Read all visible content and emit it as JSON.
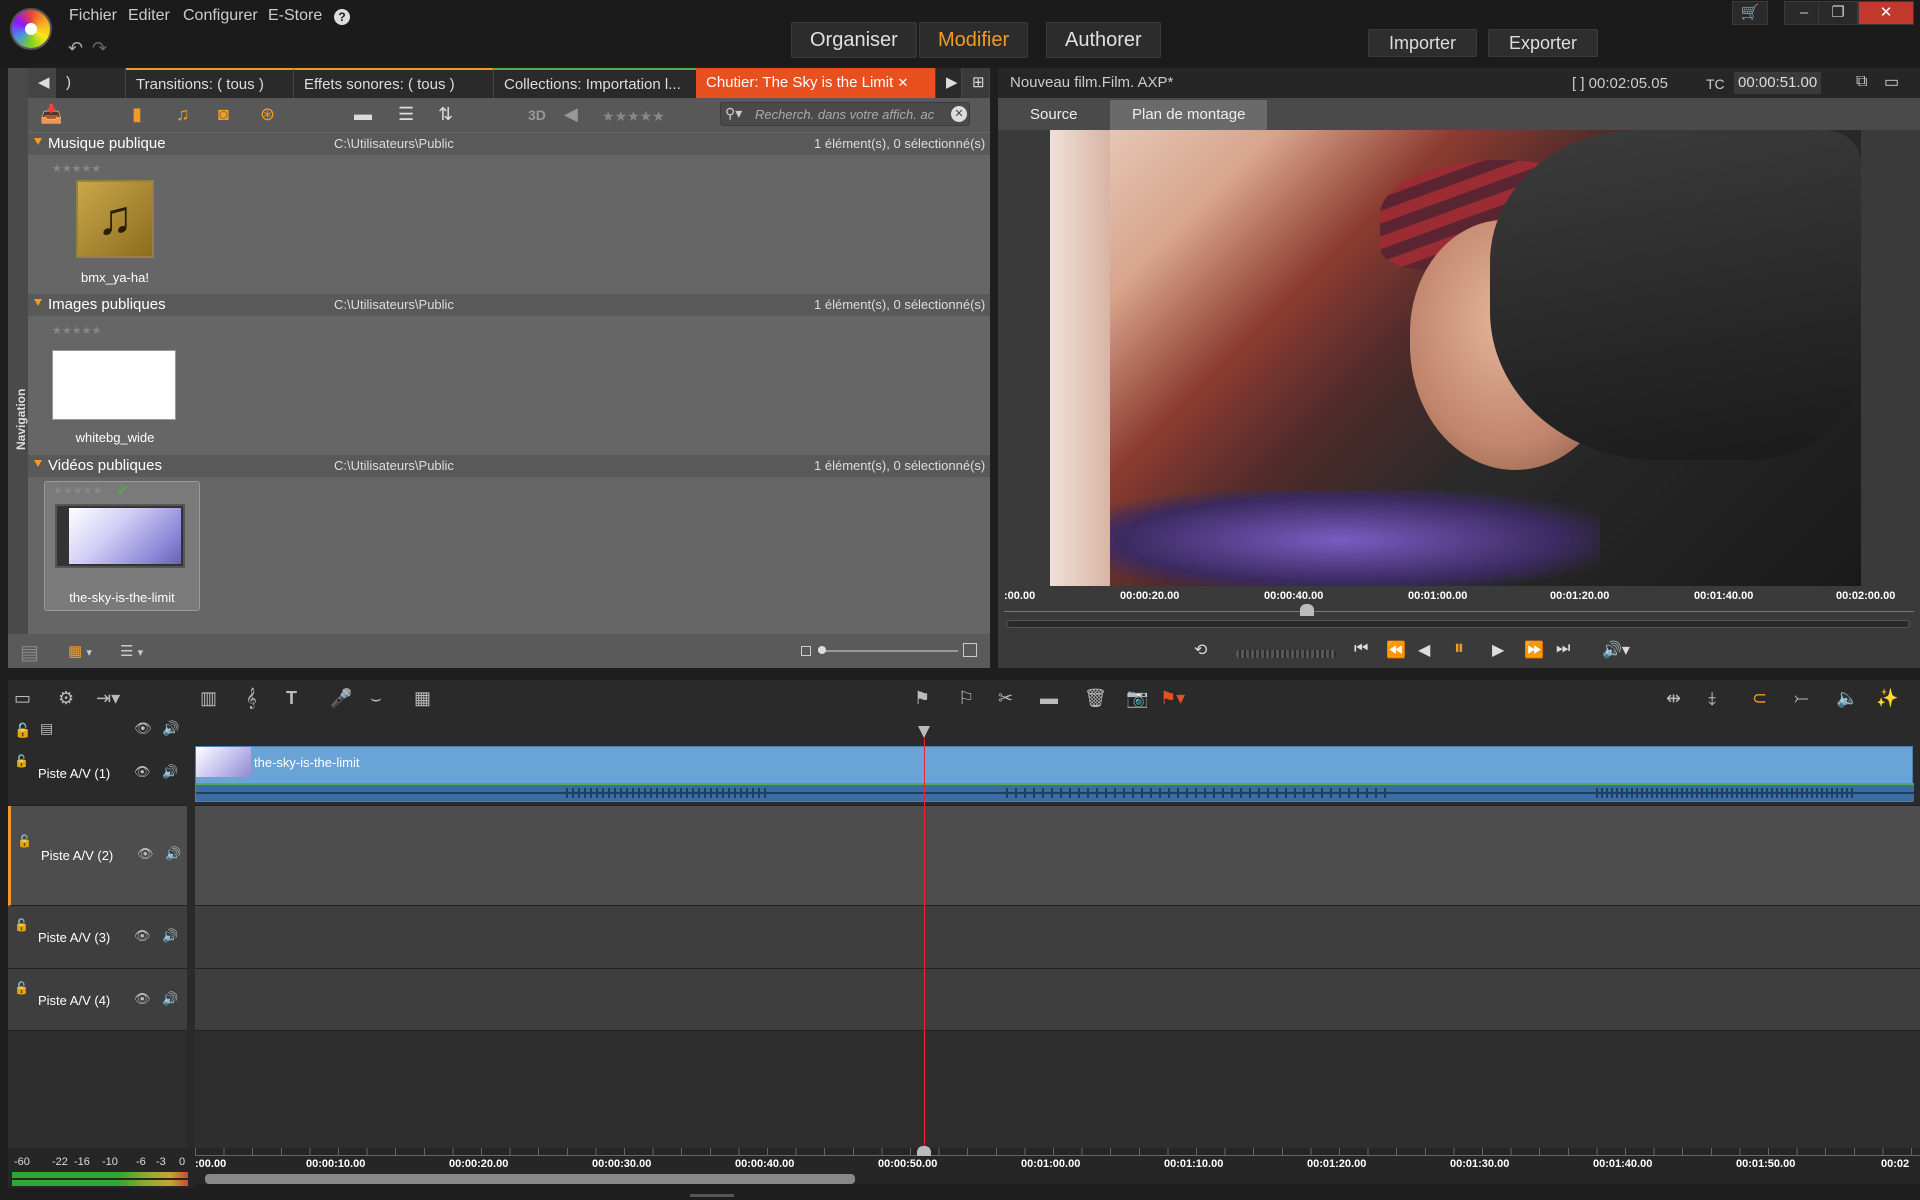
{
  "menu": {
    "fichier": "Fichier",
    "editer": "Editer",
    "configurer": "Configurer",
    "estore": "E-Store"
  },
  "modes": {
    "organiser": "Organiser",
    "modifier": "Modifier",
    "authorer": "Authorer"
  },
  "io": {
    "importer": "Importer",
    "exporter": "Exporter"
  },
  "tabs": {
    "first": ")",
    "transitions": "Transitions: ( tous )",
    "effets": "Effets sonores: ( tous )",
    "collections": "Collections: Importation l...",
    "chutier": "Chutier: The Sky is the Limit"
  },
  "toolbar": {
    "label_3d": "3D",
    "search_placeholder": "Recherch. dans votre affich. ac"
  },
  "sections": [
    {
      "title": "Musique publique",
      "path": "C:\\Utilisateurs\\Public",
      "count": "1 élément(s), 0 sélectionné(s)",
      "item": "bmx_ya-ha!"
    },
    {
      "title": "Images publiques",
      "path": "C:\\Utilisateurs\\Public",
      "count": "1 élément(s), 0 sélectionné(s)",
      "item": "whitebg_wide"
    },
    {
      "title": "Vidéos publiques",
      "path": "C:\\Utilisateurs\\Public",
      "count": "1 élément(s), 0 sélectionné(s)",
      "item": "the-sky-is-the-limit"
    }
  ],
  "nav_label": "Navigation",
  "preview": {
    "title": "Nouveau film.Film. AXP*",
    "duration": "[ ] 00:02:05.05",
    "tc_label": "TC",
    "tc_value": "00:00:51.00",
    "tab_source": "Source",
    "tab_plan": "Plan de montage"
  },
  "preview_ruler": [
    ":00.00",
    "00:00:20.00",
    "00:00:40.00",
    "00:01:00.00",
    "00:01:20.00",
    "00:01:40.00",
    "00:02:00.00"
  ],
  "tracks": [
    "Piste A/V (1)",
    "Piste A/V (2)",
    "Piste A/V (3)",
    "Piste A/V (4)"
  ],
  "clip": {
    "name": "the-sky-is-the-limit"
  },
  "timeline_ruler": [
    ":00.00",
    "00:00:10.00",
    "00:00:20.00",
    "00:00:30.00",
    "00:00:40.00",
    "00:00:50.00",
    "00:01:00.00",
    "00:01:10.00",
    "00:01:20.00",
    "00:01:30.00",
    "00:01:40.00",
    "00:01:50.00",
    "00:02"
  ],
  "meter_labels": [
    "-60",
    "-22",
    "-16",
    "-10",
    "-6",
    "-3",
    "0"
  ],
  "colors": {
    "accent": "#f39a24",
    "active_tab": "#e8501f",
    "clip": "#6aa3d5",
    "playhead": "#e22233"
  }
}
